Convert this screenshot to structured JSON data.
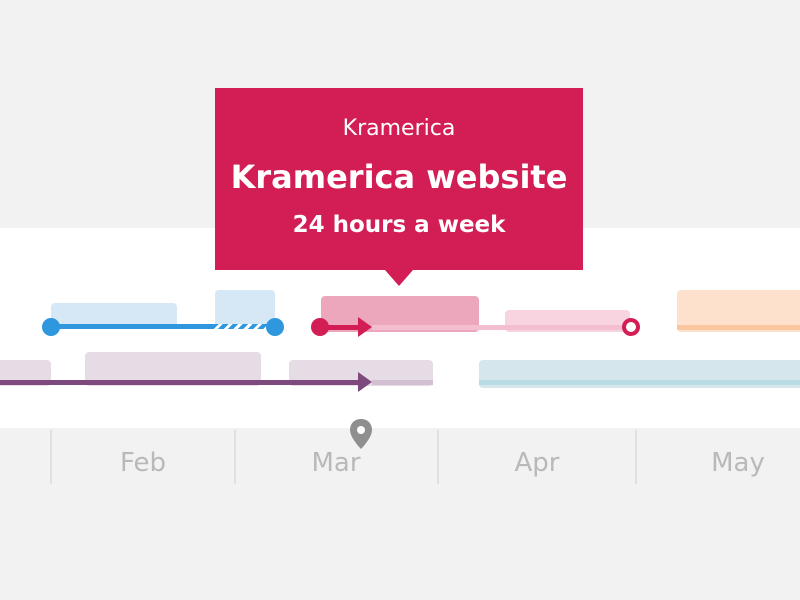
{
  "tooltip": {
    "client": "Kramerica",
    "project": "Kramerica website",
    "hours": "24 hours a week",
    "color": "#d21d55"
  },
  "timeline": {
    "months": [
      "Feb",
      "Mar",
      "Apr",
      "May"
    ],
    "marker_icon": "location-pin-icon"
  },
  "colors": {
    "blue": "#2f97dd",
    "pink": "#d21d55",
    "purple": "#7e4a7d",
    "teal": "#b9dbe4",
    "orange": "#f9c69f"
  }
}
